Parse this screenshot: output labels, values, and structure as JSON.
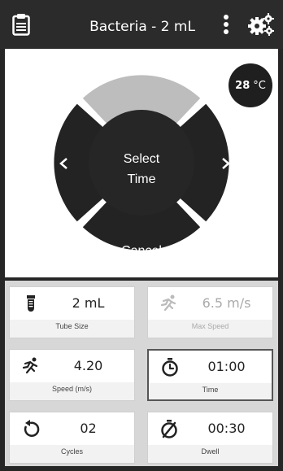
{
  "header": {
    "title": "Bacteria - 2 mL",
    "icons": [
      "clipboard-icon",
      "more-vert-icon",
      "gears-icon"
    ]
  },
  "temperature": {
    "value": "28",
    "unit": "°C"
  },
  "wheel": {
    "center_line1": "Select",
    "center_line2": "Time",
    "left_arrow": "‹",
    "right_arrow": "›",
    "cancel_label": "Cancel"
  },
  "cards": [
    {
      "value": "2 mL",
      "label": "Tube Size",
      "icon": "tube-icon",
      "disabled": false
    },
    {
      "value": "6.5 m/s",
      "label": "Max Speed",
      "icon": "runner-icon",
      "disabled": true
    },
    {
      "value": "4.20",
      "label": "Speed (m/s)",
      "icon": "runner-icon",
      "disabled": false
    },
    {
      "value": "01:00",
      "label": "Time",
      "icon": "timer-icon",
      "disabled": false,
      "selected": true
    },
    {
      "value": "02",
      "label": "Cycles",
      "icon": "repeat-icon",
      "disabled": false
    },
    {
      "value": "00:30",
      "label": "Dwell",
      "icon": "dwell-icon",
      "disabled": false
    }
  ]
}
